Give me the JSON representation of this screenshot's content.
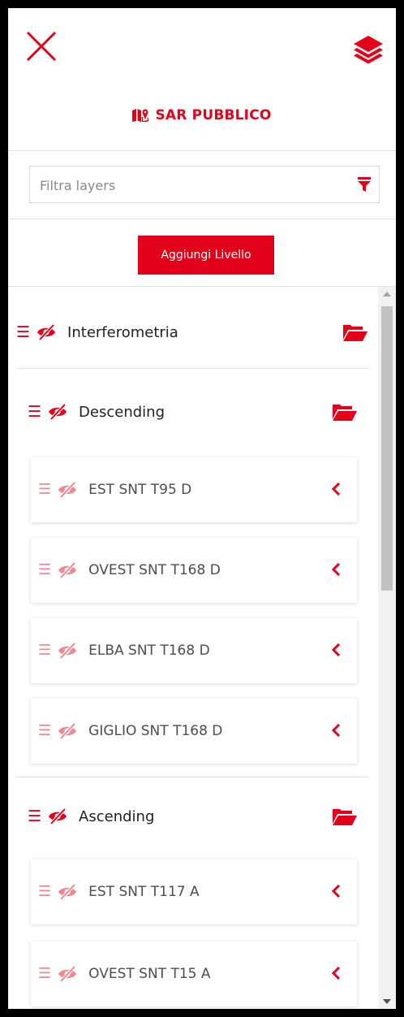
{
  "header": {
    "title": "SAR PUBBLICO",
    "close_icon": "close-icon",
    "layers_icon": "layers-icon"
  },
  "filter": {
    "placeholder": "Filtra layers",
    "value": ""
  },
  "add_button": {
    "label": "Aggiungi Livello"
  },
  "tree": {
    "root": {
      "label": "Interferometria"
    },
    "groups": [
      {
        "label": "Descending",
        "items": [
          {
            "label": "EST SNT T95 D"
          },
          {
            "label": "OVEST SNT T168 D"
          },
          {
            "label": "ELBA SNT T168 D"
          },
          {
            "label": "GIGLIO SNT T168 D"
          }
        ]
      },
      {
        "label": "Ascending",
        "items": [
          {
            "label": "EST SNT T117 A"
          },
          {
            "label": "OVEST SNT T15 A"
          }
        ]
      }
    ]
  },
  "colors": {
    "accent": "#e2001a",
    "accent_light": "#f08792",
    "text": "#222222"
  }
}
